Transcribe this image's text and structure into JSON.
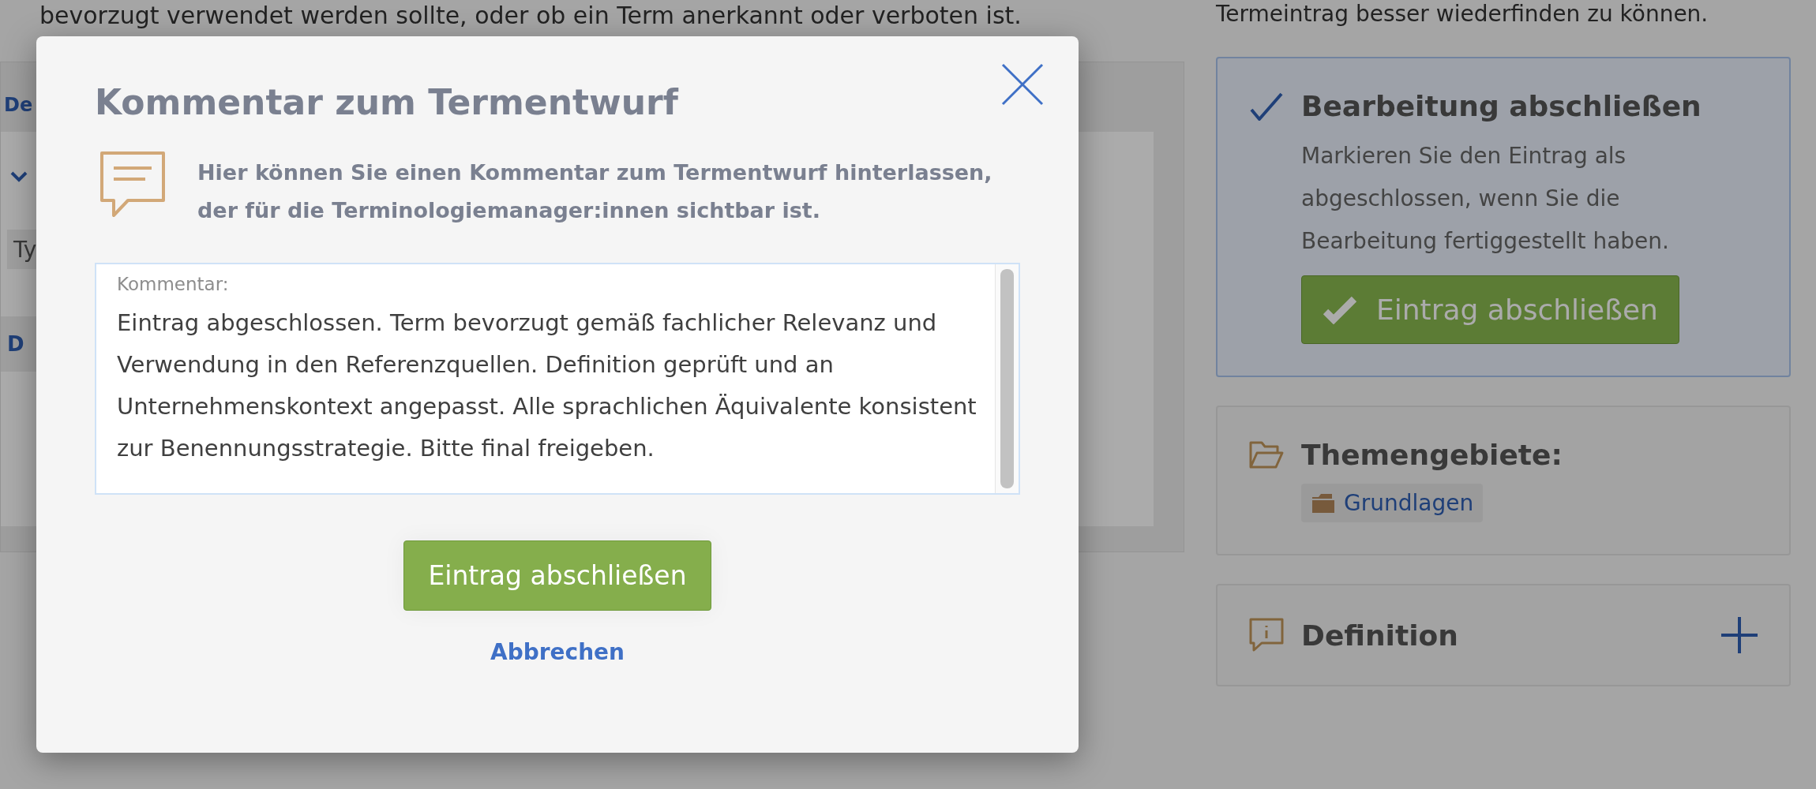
{
  "background": {
    "left_top_text": "bevorzugt verwendet werden sollte, oder ob ein Term anerkannt oder verboten ist.",
    "right_top_text": "Termeintrag besser wiederfinden zu können.",
    "left_panel": {
      "heading_fragment": "De",
      "field_fragment": "Ty",
      "link_fragment": "D"
    },
    "finish_card": {
      "title": "Bearbeitung abschließen",
      "text": "Markieren Sie den Eintrag als abgeschlossen, wenn Sie die Bearbeitung fertiggestellt haben.",
      "button": "Eintrag abschließen"
    },
    "subject_card": {
      "title": "Themengebiete:",
      "tags": [
        "Grundlagen"
      ]
    },
    "definition_card": {
      "title": "Definition"
    }
  },
  "modal": {
    "title": "Kommentar zum Termentwurf",
    "description": "Hier können Sie einen Kommentar zum Termentwurf hinterlassen, der für die Terminologiemanager:innen sichtbar ist.",
    "comment_field": {
      "label": "Kommentar:",
      "value": "Eintrag abgeschlossen. Term bevorzugt gemäß fachlicher Relevanz und Verwendung in den Referenzquellen. Definition geprüft und an Unternehmenskontext angepasst. Alle sprachlichen Äquivalente konsistent zur Benennungsstrategie. Bitte final freigeben."
    },
    "confirm_button": "Eintrag abschließen",
    "cancel_link": "Abbrechen"
  }
}
